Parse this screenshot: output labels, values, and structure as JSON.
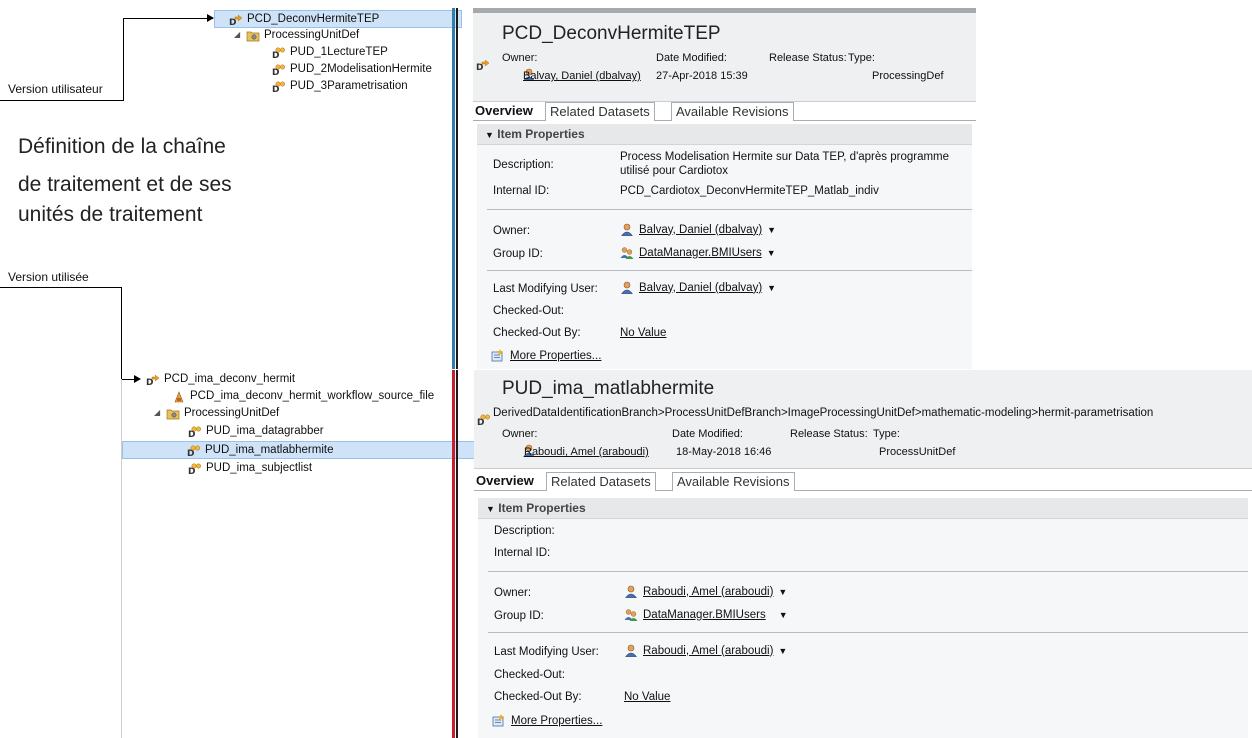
{
  "annotations": {
    "version_utilisateur": "Version utilisateur",
    "version_utilisee": "Version utilisée",
    "definition_line1": "Définition de la chaîne",
    "definition_line2": "de traitement et de ses",
    "definition_line3": "unités de traitement"
  },
  "tree_top": {
    "root": "PCD_DeconvHermiteTEP",
    "group": "ProcessingUnitDef",
    "children": [
      "PUD_1LectureTEP",
      "PUD_2ModelisationHermite",
      "PUD_3Parametrisation"
    ]
  },
  "tree_bottom": {
    "root": "PCD_ima_deconv_hermit",
    "file": "PCD_ima_deconv_hermit_workflow_source_file",
    "group": "ProcessingUnitDef",
    "children": [
      "PUD_ima_datagrabber",
      "PUD_ima_matlabhermite",
      "PUD_ima_subjectlist"
    ]
  },
  "panel_top": {
    "title": "PCD_DeconvHermiteTEP",
    "labels": {
      "owner": "Owner:",
      "date_modified": "Date Modified:",
      "release_status": "Release Status:",
      "type": "Type:"
    },
    "owner": "Balvay, Daniel (dbalvay)",
    "date_modified": "27-Apr-2018 15:39",
    "type": "ProcessingDef",
    "tabs": [
      "Overview",
      "Related Datasets",
      "Available Revisions"
    ],
    "section": "Item Properties",
    "props": {
      "description_label": "Description:",
      "description": "Process Modelisation Hermite sur Data TEP, d'après programme",
      "description2": "utilisé pour Cardiotox",
      "internal_id_label": "Internal ID:",
      "internal_id": "PCD_Cardiotox_DeconvHermiteTEP_Matlab_indiv",
      "owner_label": "Owner:",
      "owner": "Balvay, Daniel (dbalvay)",
      "group_label": "Group ID:",
      "group": "DataManager.BMIUsers",
      "last_mod_label": "Last Modifying User:",
      "last_mod": "Balvay, Daniel (dbalvay)",
      "checked_out_label": "Checked-Out:",
      "checked_out_by_label": "Checked-Out By:",
      "checked_out_by": "No Value",
      "more": "More Properties..."
    }
  },
  "panel_bottom": {
    "title": "PUD_ima_matlabhermite",
    "breadcrumb": "DerivedDataIdentificationBranch>ProcessUnitDefBranch>ImageProcessingUnitDef>mathematic-modeling>hermit-parametrisation",
    "labels": {
      "owner": "Owner:",
      "date_modified": "Date Modified:",
      "release_status": "Release Status:",
      "type": "Type:"
    },
    "owner": "Raboudi, Amel (araboudi)",
    "date_modified": "18-May-2018 16:46",
    "type": "ProcessUnitDef",
    "tabs": [
      "Overview",
      "Related Datasets",
      "Available Revisions"
    ],
    "section": "Item Properties",
    "props": {
      "description_label": "Description:",
      "internal_id_label": "Internal ID:",
      "owner_label": "Owner:",
      "owner": "Raboudi, Amel (araboudi)",
      "group_label": "Group ID:",
      "group": "DataManager.BMIUsers",
      "last_mod_label": "Last Modifying User:",
      "last_mod": "Raboudi, Amel (araboudi)",
      "checked_out_label": "Checked-Out:",
      "checked_out_by_label": "Checked-Out By:",
      "checked_out_by": "No Value",
      "more": "More Properties..."
    }
  },
  "colors": {
    "top_divider": "#2e7fb0",
    "bottom_divider": "#c8202a",
    "selection": "#cfe3f8"
  }
}
